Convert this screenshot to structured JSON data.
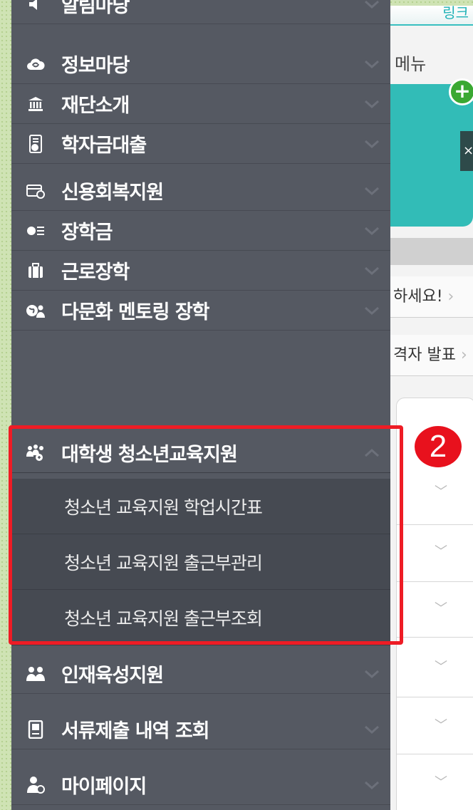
{
  "background_page": {
    "top_link": "링크",
    "menu_label": "메뉴",
    "notices": [
      "하세요!",
      "격자 발표"
    ]
  },
  "badge": "2",
  "drawer": {
    "items": [
      {
        "label": "알림마당",
        "icon": "speaker-icon"
      },
      {
        "label": "정보마당",
        "icon": "cloud-refresh-icon"
      },
      {
        "label": "재단소개",
        "icon": "institution-icon"
      },
      {
        "label": "학자금대출",
        "icon": "loan-document-icon"
      },
      {
        "label": "신용회복지원",
        "icon": "credit-card-icon"
      },
      {
        "label": "장학금",
        "icon": "coin-list-icon"
      },
      {
        "label": "근로장학",
        "icon": "briefcase-icon"
      },
      {
        "label": "다문화 멘토링 장학",
        "icon": "globe-person-icon"
      },
      {
        "label": "대학생 청소년교육지원",
        "icon": "group-icon",
        "expanded": true
      },
      {
        "label": "인재육성지원",
        "icon": "people-icon"
      },
      {
        "label": "서류제출 내역 조회",
        "icon": "document-icon"
      },
      {
        "label": "마이페이지",
        "icon": "user-settings-icon"
      }
    ],
    "subitems": [
      {
        "label": "청소년 교육지원 학업시간표"
      },
      {
        "label": "청소년 교육지원 출근부관리"
      },
      {
        "label": "청소년 교육지원 출근부조회"
      }
    ]
  },
  "colors": {
    "drawer_bg": "#555962",
    "submenu_bg": "#464a52",
    "highlight": "#ee1c25",
    "badge": "#e8111d",
    "accent_teal": "#32bcb7"
  }
}
